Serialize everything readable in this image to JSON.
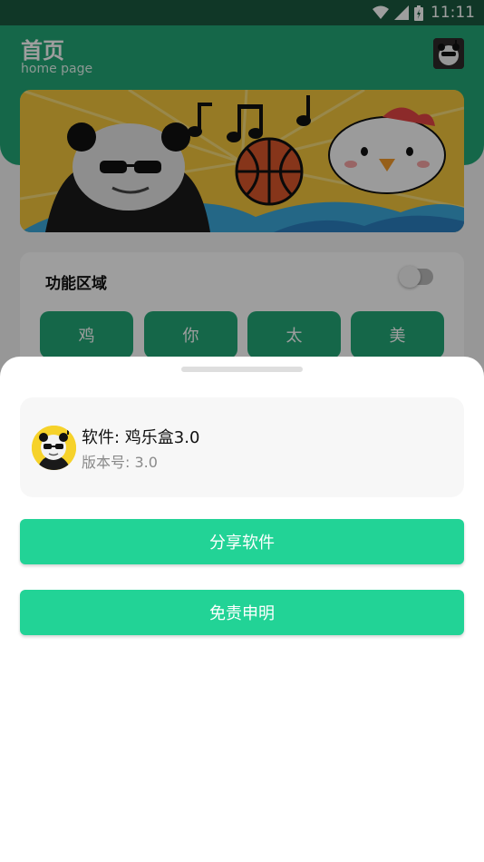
{
  "status_bar": {
    "time": "11:11",
    "icons": [
      "wifi-icon",
      "signal-icon",
      "battery-icon"
    ]
  },
  "page": {
    "title": "首页",
    "subtitle": "home page"
  },
  "function_area": {
    "title": "功能区域",
    "toggle_on": false,
    "buttons": [
      "鸡",
      "你",
      "太",
      "美"
    ]
  },
  "sheet": {
    "app_name": "软件: 鸡乐盒3.0",
    "version": "版本号: 3.0",
    "share_label": "分享软件",
    "disclaimer_label": "免责申明"
  },
  "colors": {
    "accent": "#22a777",
    "button": "#22d396",
    "status_bar": "#1a5a3f"
  }
}
